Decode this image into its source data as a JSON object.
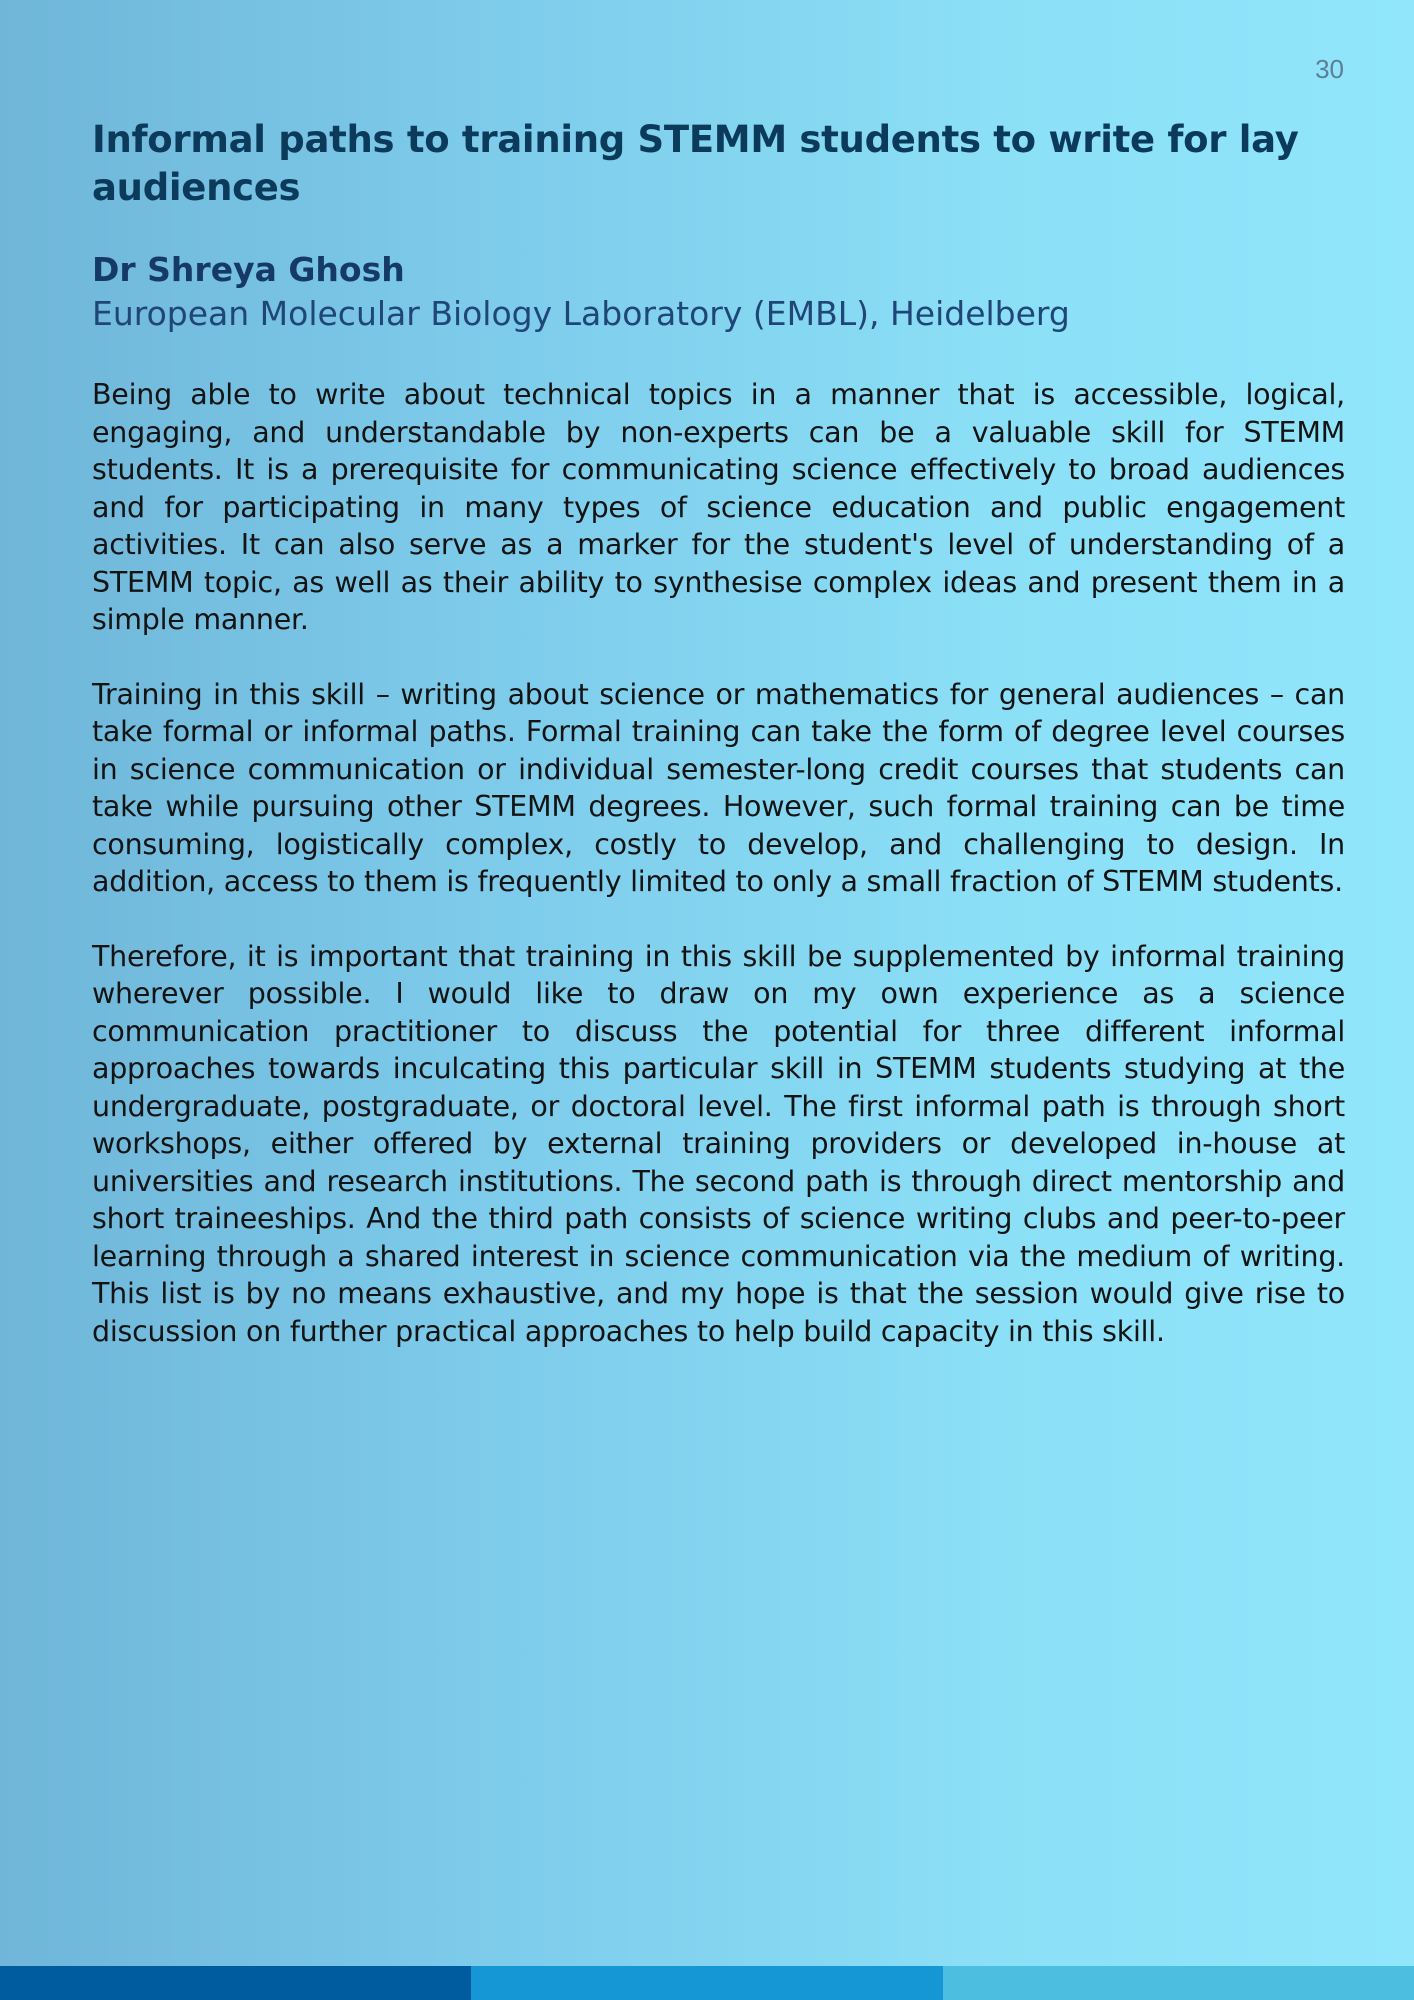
{
  "page_number": "30",
  "title": "Informal paths to training STEMM students to write for lay audiences",
  "author": {
    "name": "Dr Shreya Ghosh",
    "affiliation": "European Molecular Biology Laboratory (EMBL), Heidelberg"
  },
  "abstract": [
    "Being able to write about technical topics in a manner that is accessible, logical, engaging, and understandable by non-experts can be a valuable skill for STEMM students. It is a prerequisite for communicating science effectively to broad audiences and for participating in many types of science education and public engagement activities. It can also serve as a marker for the student's level of understanding of a STEMM topic, as well as their ability to synthesise complex ideas and present them in a simple manner.",
    "Training in this skill – writing about science or mathematics for general audiences – can take formal or informal paths. Formal training can take the form of degree level courses in science communication or individual semester-long credit courses that students can take while pursuing other STEMM degrees. However, such formal training can be time consuming, logistically complex, costly to develop, and challenging to design. In addition, access to them is frequently limited to only a small fraction of STEMM students.",
    "Therefore, it is important that training in this skill be supplemented by informal training wherever possible. I would like to draw on my own experience as a science communication practitioner to discuss the potential for three different informal approaches towards inculcating this particular skill in STEMM students studying at the undergraduate, postgraduate, or doctoral level. The first informal path is through short workshops, either offered by external training providers or developed in-house at universities and research institutions. The second path is through direct mentorship and short traineeships. And the third path consists of science writing clubs and peer-to-peer learning through a shared interest in science communication via the medium of writing. This list is by no means exhaustive, and my hope is that the session would give rise to discussion on further practical approaches to help build capacity in this skill."
  ],
  "colors": {
    "title": "#0c3a5a",
    "author": "#163a66",
    "footer_segments": [
      "#005c9f",
      "#1497d4",
      "#4cbfe0"
    ]
  }
}
